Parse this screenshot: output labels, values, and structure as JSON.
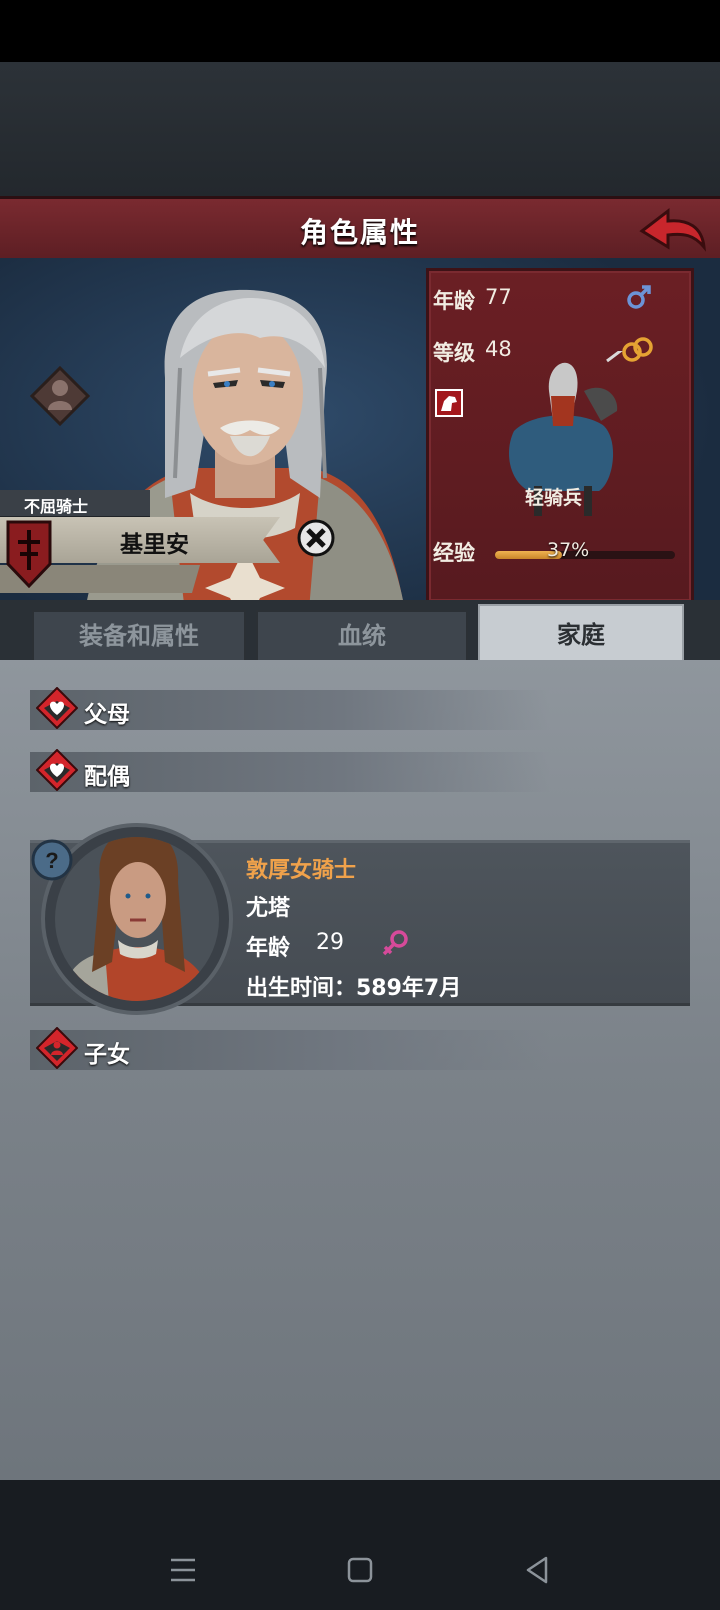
{
  "header": {
    "title": "角色属性"
  },
  "character": {
    "title": "不屈骑士",
    "name": "基里安",
    "age_label": "年龄",
    "age": "77",
    "level_label": "等级",
    "level": "48",
    "gender_icon": "male-symbol-icon",
    "married_icon": "rings-icon",
    "unit": "轻骑兵",
    "exp_label": "经验",
    "exp_percent": "37%",
    "exp_fraction": 0.37
  },
  "tabs": [
    {
      "label": "装备和属性"
    },
    {
      "label": "血统"
    },
    {
      "label": "家庭"
    }
  ],
  "family": {
    "parents_label": "父母",
    "spouse_label": "配偶",
    "children_label": "子女",
    "spouse": {
      "title": "敦厚女骑士",
      "name": "尤塔",
      "age_label": "年龄",
      "age": "29",
      "birth": "出生时间：589年7月"
    }
  },
  "colors": {
    "accent_red": "#6b1f24",
    "spouse_title": "#f0a24b",
    "exp_fill": "#f0b451",
    "female_icon": "#d64a9a",
    "male_icon": "#6c93d6"
  }
}
